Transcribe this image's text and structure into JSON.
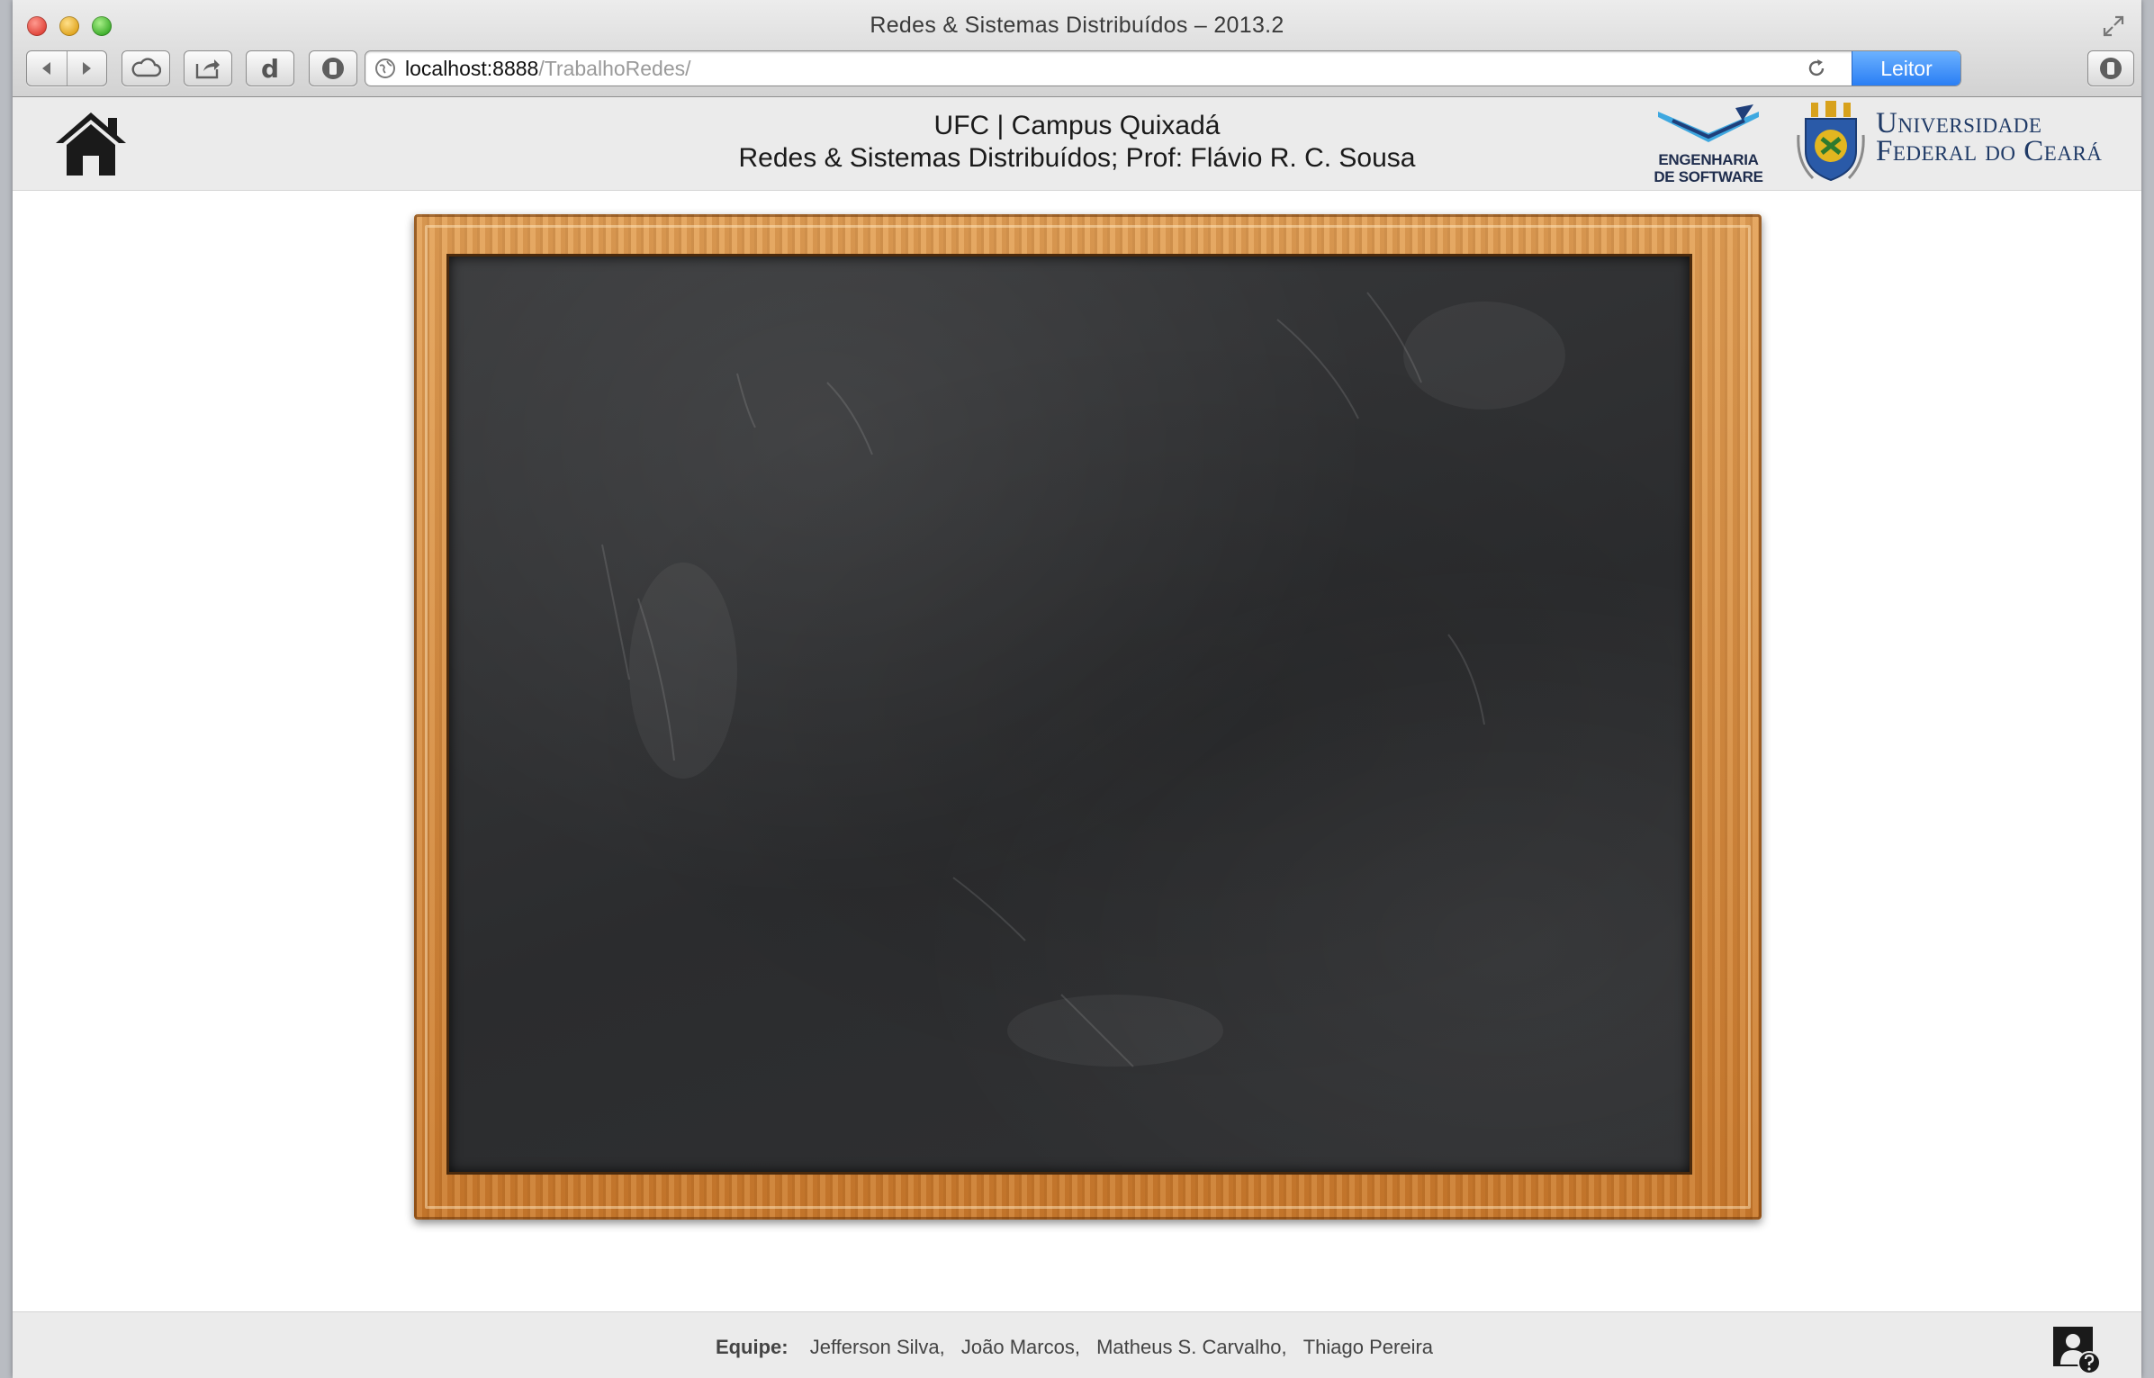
{
  "window": {
    "title": "Redes & Sistemas Distribuídos – 2013.2"
  },
  "toolbar": {
    "back_icon": "chevron-left-icon",
    "forward_icon": "chevron-right-icon",
    "cloud_icon": "cloud-icon",
    "share_icon": "share-icon",
    "d_label": "d",
    "reader_label": "Leitor"
  },
  "address": {
    "host": "localhost:8888",
    "path": "/TrabalhoRedes/"
  },
  "header": {
    "line1": "UFC | Campus Quixadá",
    "line2": "Redes & Sistemas Distribuídos; Prof: Flávio R. C. Sousa",
    "es_logo_line1": "ENGENHARIA",
    "es_logo_line2": "DE SOFTWARE",
    "ufc_line1": "Universidade",
    "ufc_line2": "Federal do Ceará"
  },
  "footer": {
    "team_label": "Equipe:",
    "members": [
      "Jefferson Silva,",
      "João Marcos,",
      "Matheus S. Carvalho,",
      "Thiago Pereira"
    ]
  },
  "colors": {
    "reader_button": "#2a7ef4",
    "header_bg": "#ebebeb",
    "board": "#2f3032",
    "frame": "#d68c40"
  }
}
